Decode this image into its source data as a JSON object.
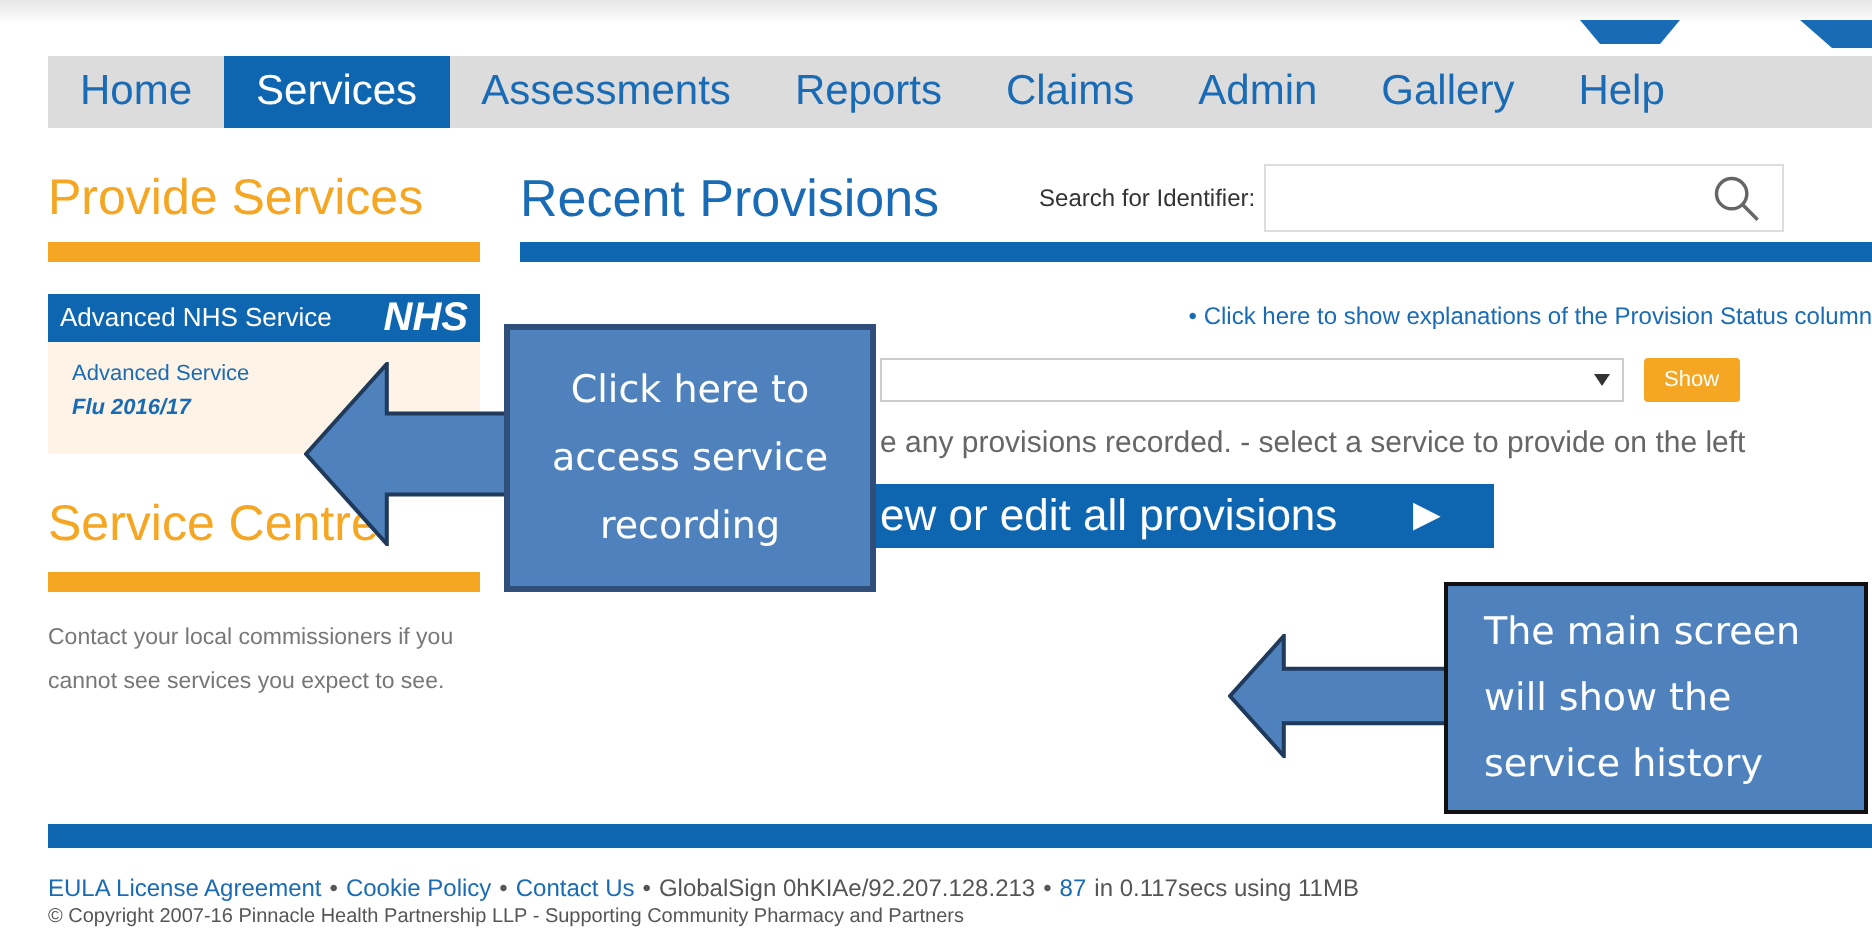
{
  "nav": {
    "tabs": [
      {
        "label": "Home",
        "selected": false
      },
      {
        "label": "Services",
        "selected": true
      },
      {
        "label": "Assessments",
        "selected": false
      },
      {
        "label": "Reports",
        "selected": false
      },
      {
        "label": "Claims",
        "selected": false
      },
      {
        "label": "Admin",
        "selected": false
      },
      {
        "label": "Gallery",
        "selected": false
      },
      {
        "label": "Help",
        "selected": false
      }
    ]
  },
  "sidebar": {
    "title": "Provide Services",
    "service_card": {
      "header": "Advanced NHS Service",
      "logo": "NHS",
      "type": "Advanced Service",
      "name": "Flu 2016/17"
    },
    "centre_title": "Service Centre",
    "centre_text": "Contact your local commissioners if you cannot see services you expect to see."
  },
  "main": {
    "title": "Recent Provisions",
    "search_label": "Search for Identifier:",
    "explain_link": "• Click here to show explanations of the Provision Status column",
    "show_button": "Show",
    "message": "e any provisions recorded. - select a service to provide on the left",
    "all_button": "ew or edit all provisions",
    "all_button_arrow": "▶"
  },
  "callouts": [
    {
      "text": "Click here to access service recording"
    },
    {
      "text": "The main screen will show the service history"
    }
  ],
  "footer": {
    "separator": "•",
    "links": [
      "EULA License Agreement",
      "Cookie Policy",
      "Contact Us"
    ],
    "info": "GlobalSign 0hKIAe/92.207.128.213",
    "count": "87",
    "timing": "in 0.117secs using 11MB",
    "copyright": "© Copyright 2007-16 Pinnacle Health Partnership LLP - Supporting Community Pharmacy and Partners"
  }
}
